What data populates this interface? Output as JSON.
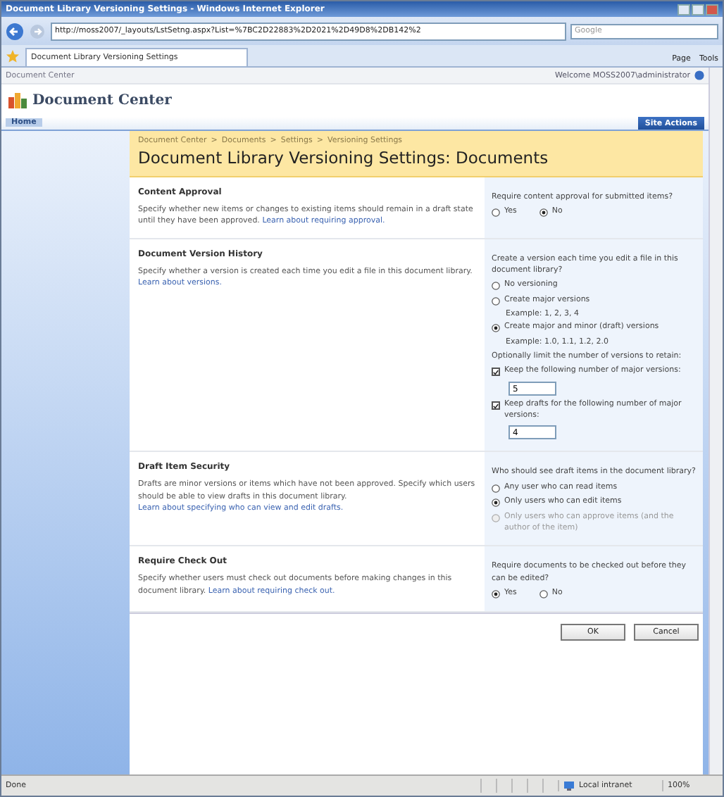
{
  "window": {
    "title": "Document Library Versioning Settings - Windows Internet Explorer"
  },
  "address_bar": {
    "url": "http://moss2007/_layouts/LstSetng.aspx?List=%7BC2D22883%2D2021%2D49D8%2DB142%2",
    "search_placeholder": "Google"
  },
  "tab": {
    "label": "Document Library Versioning Settings"
  },
  "command_bar": [
    "Page",
    "Tools"
  ],
  "site": {
    "breadcrumb": "Document Center",
    "welcome": "Welcome MOSS2007\\administrator",
    "title": "Document Center",
    "nav": [
      {
        "label": "Home",
        "selected": true
      }
    ],
    "site_actions": "Site Actions"
  },
  "page": {
    "breadcrumb": [
      {
        "label": "Document Center"
      },
      {
        "label": "Documents"
      },
      {
        "label": "Settings"
      },
      {
        "label": "Versioning Settings"
      }
    ],
    "separator": ">",
    "title": "Document Library Versioning Settings: Documents"
  },
  "sections": [
    {
      "title": "Content Approval",
      "description": "Specify whether new items or changes to existing items should remain in a draft state until they have been approved.",
      "link": "Learn about requiring approval.",
      "controls": [
        {
          "kind": "text",
          "text": "Require content approval for submitted items?"
        },
        {
          "kind": "choice-row",
          "options": [
            {
              "label": "Yes",
              "selected": false
            },
            {
              "label": "No",
              "selected": true
            }
          ]
        }
      ]
    },
    {
      "title": "Document Version History",
      "description": "Specify whether a version is created each time you edit a file in this document library.",
      "link": "Learn about versions.",
      "controls": [
        {
          "kind": "text",
          "text": "Create a version each time you edit a file in this document library?"
        },
        {
          "kind": "radio",
          "label": "No versioning",
          "selected": false,
          "disabled": false
        },
        {
          "kind": "radio",
          "label": "Create major versions",
          "selected": false,
          "disabled": false
        },
        {
          "kind": "example",
          "text": "Example: 1, 2, 3, 4"
        },
        {
          "kind": "radio",
          "label": "Create major and minor (draft) versions",
          "selected": true,
          "disabled": false
        },
        {
          "kind": "example",
          "text": "Example: 1.0, 1.1, 1.2, 2.0"
        },
        {
          "kind": "text",
          "text": "Optionally limit the number of versions to retain:"
        },
        {
          "kind": "checkbox",
          "label": "Keep the following number of major versions:",
          "checked": true,
          "value": "5"
        },
        {
          "kind": "checkbox",
          "label": "Keep drafts for the following number of major versions:",
          "checked": true,
          "value": "4"
        }
      ]
    },
    {
      "title": "Draft Item Security",
      "description": "Drafts are minor versions or items which have not been approved. Specify which users should be able to view drafts in this document library.",
      "link": "Learn about specifying who can view and edit drafts.",
      "controls": [
        {
          "kind": "text",
          "text": "Who should see draft items in the document library?"
        },
        {
          "kind": "radio",
          "label": "Any user who can read items",
          "selected": false,
          "disabled": false
        },
        {
          "kind": "radio",
          "label": "Only users who can edit items",
          "selected": true,
          "disabled": false
        },
        {
          "kind": "radio",
          "label": "Only users who can approve items (and the author of the item)",
          "selected": false,
          "disabled": true
        }
      ]
    },
    {
      "title": "Require Check Out",
      "description": "Specify whether users must check out documents before making changes in this document library.",
      "link": "Learn about requiring check out.",
      "controls": [
        {
          "kind": "text",
          "text": "Require documents to be checked out before they can be edited?"
        },
        {
          "kind": "choice-row",
          "options": [
            {
              "label": "Yes",
              "selected": true
            },
            {
              "label": "No",
              "selected": false
            }
          ]
        }
      ]
    }
  ],
  "buttons": [
    "OK",
    "Cancel"
  ],
  "status_bar": {
    "text": "Done",
    "zone": "Local intranet",
    "zoom": "100%"
  }
}
